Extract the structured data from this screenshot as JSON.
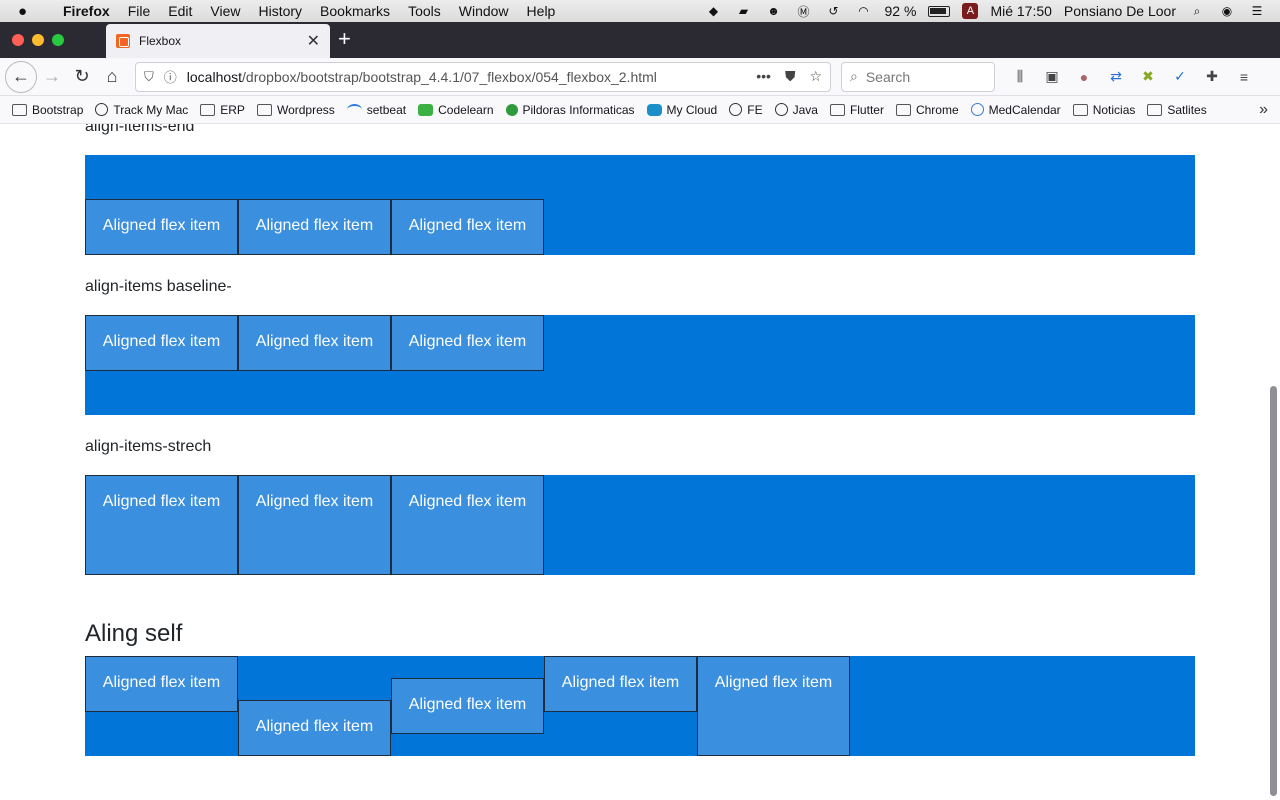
{
  "menubar": {
    "apple": "",
    "items": [
      "Firefox",
      "File",
      "Edit",
      "View",
      "History",
      "Bookmarks",
      "Tools",
      "Window",
      "Help"
    ],
    "battery": "92 %",
    "clock": "Mié 17:50",
    "user": "Ponsiano De Loor",
    "input_badge": "A"
  },
  "tab": {
    "title": "Flexbox",
    "close": "✕"
  },
  "newtab": "+",
  "navbar": {
    "url_host": "localhost",
    "url_path": "/dropbox/bootstrap/bootstrap_4.4.1/07_flexbox/054_flexbox_2.html",
    "search_placeholder": "Search"
  },
  "bookmarks": [
    {
      "label": "Bootstrap",
      "icon": "folder"
    },
    {
      "label": "Track My Mac",
      "icon": "globe"
    },
    {
      "label": "ERP",
      "icon": "folder"
    },
    {
      "label": "Wordpress",
      "icon": "folder"
    },
    {
      "label": "setbeat",
      "icon": "setbeat"
    },
    {
      "label": "Codelearn",
      "icon": "codelearn"
    },
    {
      "label": "Pildoras Informaticas",
      "icon": "pildoras"
    },
    {
      "label": "My Cloud",
      "icon": "cloud"
    },
    {
      "label": "FE",
      "icon": "globe"
    },
    {
      "label": "Java",
      "icon": "globe"
    },
    {
      "label": "Flutter",
      "icon": "folder"
    },
    {
      "label": "Chrome",
      "icon": "folder"
    },
    {
      "label": "MedCalendar",
      "icon": "med"
    },
    {
      "label": "Noticias",
      "icon": "folder"
    },
    {
      "label": "Satlites",
      "icon": "folder"
    }
  ],
  "page": {
    "label_end": "align-items-end",
    "label_baseline": "align-items baseline-",
    "label_stretch": "align-items-strech",
    "heading_self": "Aling self",
    "item_text": "Aligned flex item"
  },
  "colors": {
    "flex_bg": "#0275d8",
    "item_bg": "#3a8fde"
  }
}
